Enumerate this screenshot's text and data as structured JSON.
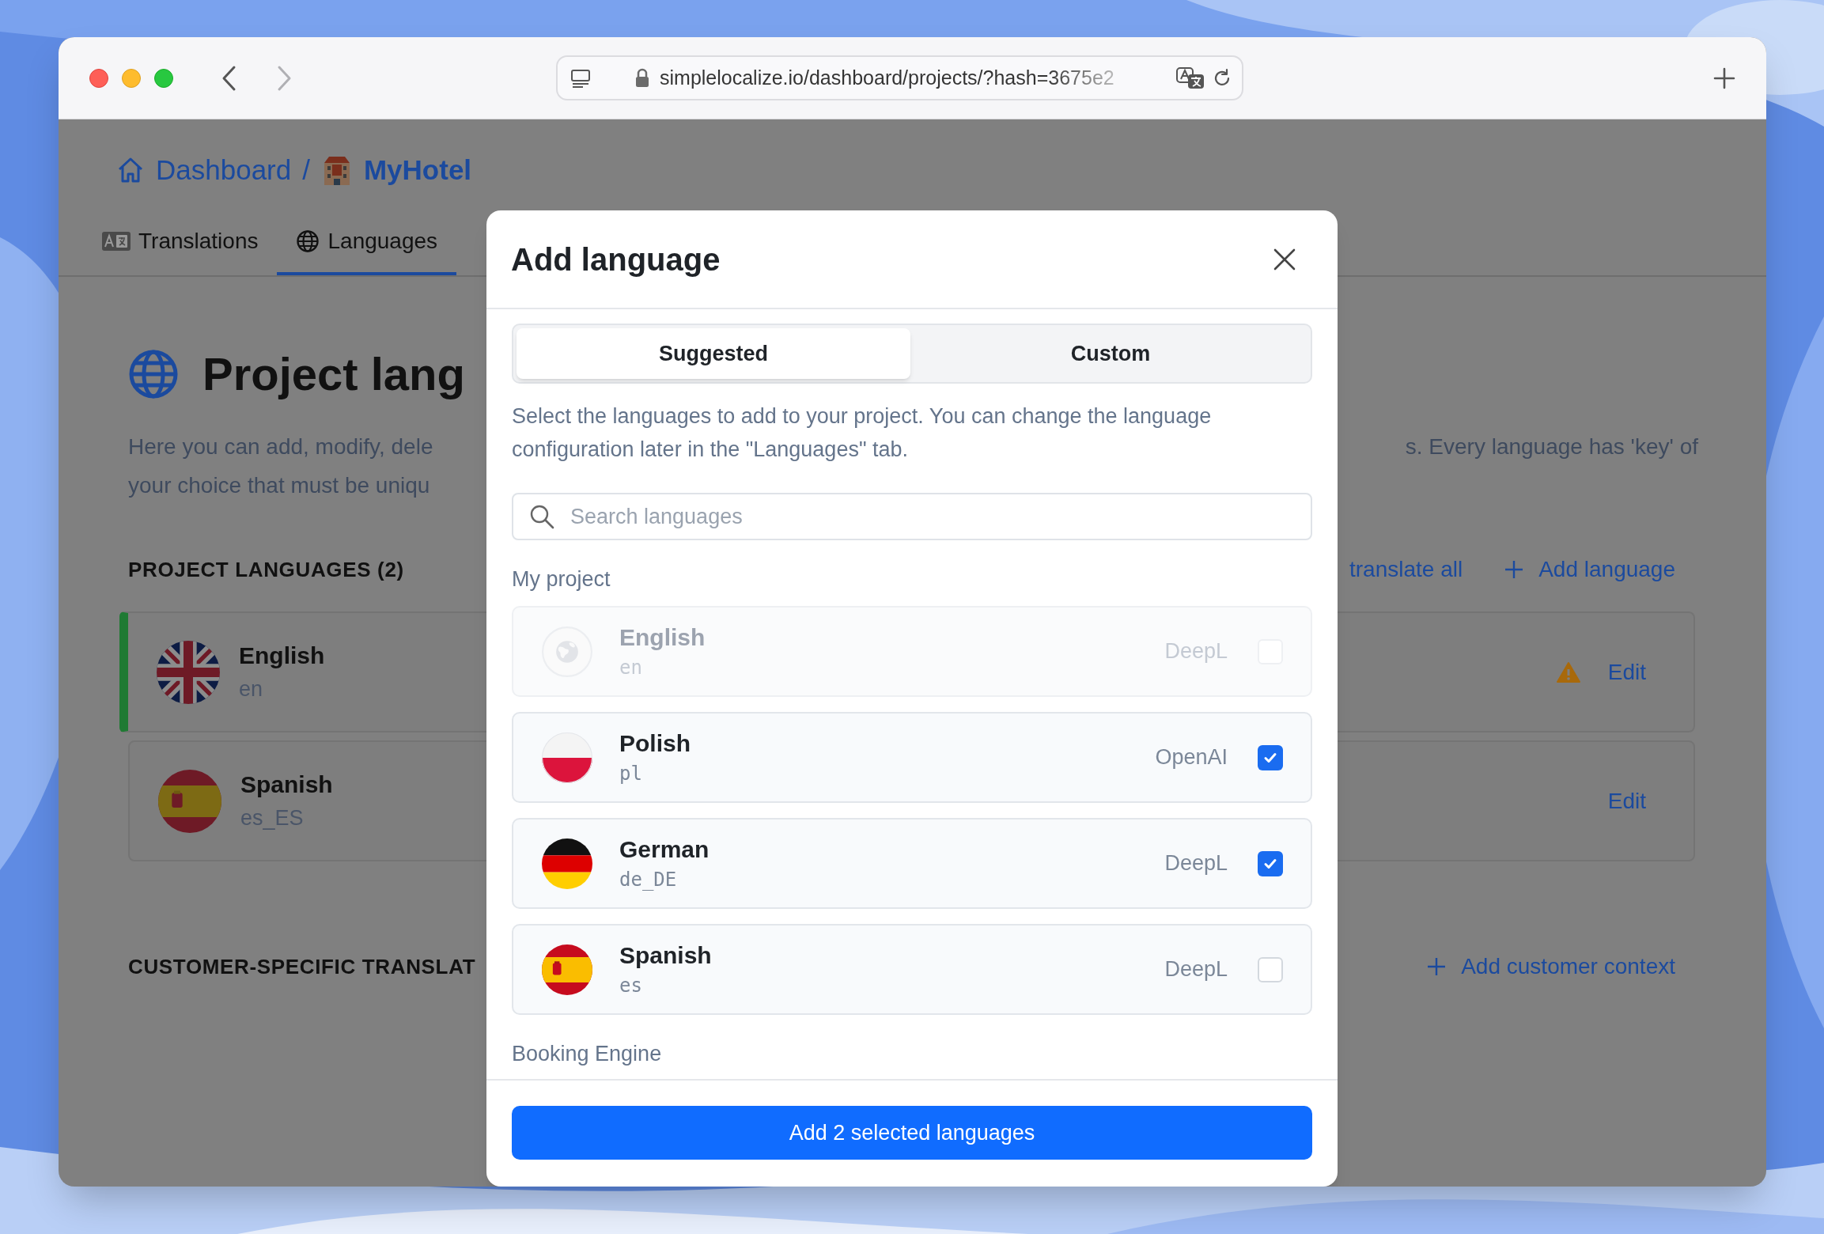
{
  "browser": {
    "url": "simplelocalize.io/dashboard/projects/?hash=3675e2"
  },
  "breadcrumb": {
    "items": [
      "Dashboard",
      "MyHotel"
    ],
    "separator": "/"
  },
  "tabs": [
    {
      "label": "Translations",
      "selected": false
    },
    {
      "label": "Languages",
      "selected": true
    }
  ],
  "page": {
    "title": "Project lang",
    "description_left": [
      "Here you can add, modify, dele",
      "your choice that must be uniqu"
    ],
    "description_right": "s. Every language has 'key' of",
    "section_title": "PROJECT LANGUAGES (2)",
    "actions": [
      {
        "label": "translate all",
        "kind": "link"
      },
      {
        "label": "Add language",
        "kind": "add"
      }
    ],
    "languages": [
      {
        "name": "English",
        "code": "en",
        "default": true,
        "warning": true,
        "action": "Edit"
      },
      {
        "name": "Spanish",
        "code": "es_ES",
        "default": false,
        "warning": false,
        "action": "Edit"
      }
    ],
    "customer_section_title": "CUSTOMER-SPECIFIC TRANSLAT",
    "customer_action": "Add customer context"
  },
  "dialog": {
    "title": "Add language",
    "tabs": [
      {
        "label": "Suggested",
        "selected": true
      },
      {
        "label": "Custom",
        "selected": false
      }
    ],
    "intro": "Select the languages to add to your project. You can change the language configuration later in the \"Languages\" tab.",
    "search": {
      "placeholder": "Search languages"
    },
    "groups": [
      {
        "title": "My project",
        "languages": [
          {
            "name": "English",
            "code": "en",
            "provider": "DeepL",
            "disabled": true,
            "checked": false
          },
          {
            "name": "Polish",
            "code": "pl",
            "provider": "OpenAI",
            "disabled": false,
            "checked": true
          },
          {
            "name": "German",
            "code": "de_DE",
            "provider": "DeepL",
            "disabled": false,
            "checked": true
          },
          {
            "name": "Spanish",
            "code": "es",
            "provider": "DeepL",
            "disabled": false,
            "checked": false
          }
        ]
      },
      {
        "title": "Booking Engine"
      }
    ],
    "submit": "Add 2 selected languages"
  }
}
